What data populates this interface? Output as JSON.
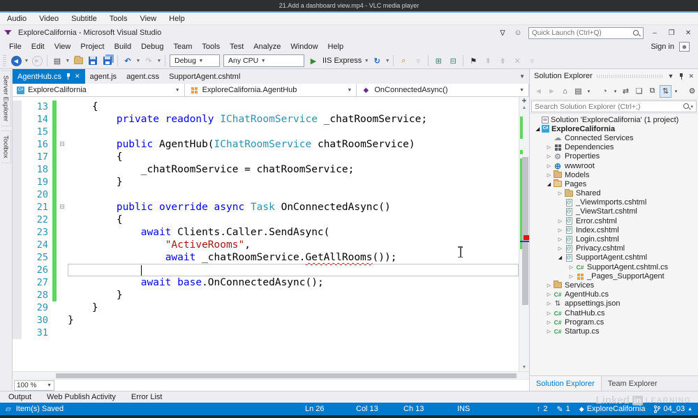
{
  "vlc": {
    "title": "21.Add a dashboard view.mp4 - VLC media player",
    "menu": [
      "Audio",
      "Video",
      "Subtitle",
      "Tools",
      "View",
      "Help"
    ]
  },
  "vs": {
    "title": "ExploreCalifornia - Microsoft Visual Studio",
    "quick_launch_placeholder": "Quick Launch (Ctrl+Q)",
    "sign_in": "Sign in",
    "window_buttons": [
      "–",
      "❐",
      "✕"
    ],
    "menu": [
      "File",
      "Edit",
      "View",
      "Project",
      "Build",
      "Debug",
      "Team",
      "Tools",
      "Test",
      "Analyze",
      "Window",
      "Help"
    ],
    "toolbar": {
      "debug_target": "Debug",
      "platform": "Any CPU",
      "run_label": "IIS Express",
      "icons": [
        {
          "type": "grip"
        },
        {
          "type": "icon",
          "name": "nav-back-icon",
          "glyph": "◀",
          "cls": "circle-blue"
        },
        {
          "type": "dd"
        },
        {
          "type": "icon",
          "name": "nav-forward-icon",
          "glyph": "▶",
          "cls": "circle-gray"
        },
        {
          "type": "sep"
        },
        {
          "type": "icon",
          "name": "new-file-icon",
          "glyph": "▤"
        },
        {
          "type": "dd"
        },
        {
          "type": "icon",
          "name": "open-folder-icon",
          "cls": "gl-folder"
        },
        {
          "type": "icon",
          "name": "save-icon",
          "cls": "gl-floppy"
        },
        {
          "type": "icon",
          "name": "save-all-icon",
          "cls": "gl-floppy gl-floppy2"
        },
        {
          "type": "sep"
        },
        {
          "type": "icon",
          "name": "undo-icon",
          "glyph": "↶",
          "color": "#2a6bc0",
          "bold": true
        },
        {
          "type": "dd"
        },
        {
          "type": "icon",
          "name": "redo-icon",
          "glyph": "↷",
          "dis": true
        },
        {
          "type": "dd"
        },
        {
          "type": "sep"
        },
        {
          "type": "combo",
          "name": "debug-target-combo",
          "bind": "debug_target",
          "width": 72
        },
        {
          "type": "combo",
          "name": "platform-combo",
          "bind": "platform",
          "width": 116
        },
        {
          "type": "icon",
          "name": "start-debug-icon",
          "glyph": "▶",
          "color": "#388a34"
        },
        {
          "type": "runlabel"
        },
        {
          "type": "dd"
        },
        {
          "type": "icon",
          "name": "refresh-icon",
          "glyph": "↻",
          "color": "#2a6bc0",
          "bold": true
        },
        {
          "type": "dd"
        },
        {
          "type": "sep"
        },
        {
          "type": "icon",
          "name": "find-in-files-icon",
          "glyph": "⌕",
          "color": "#c27d1a"
        },
        {
          "type": "icon",
          "name": "toolbar-overflow-icon",
          "glyph": "▿",
          "dis": true
        },
        {
          "type": "sep"
        },
        {
          "type": "icon",
          "name": "attach-process-icon",
          "glyph": "⊞",
          "color": "#3c7f63"
        },
        {
          "type": "icon",
          "name": "navigate-backward-doc-icon",
          "glyph": "⊟",
          "color": "#3c7f63"
        },
        {
          "type": "sep"
        },
        {
          "type": "icon",
          "name": "bookmark-icon",
          "glyph": "⚑",
          "color": "#2b2b2b"
        },
        {
          "type": "icon",
          "name": "prev-bookmark-icon",
          "glyph": "⇞",
          "dis": true
        },
        {
          "type": "icon",
          "name": "next-bookmark-icon",
          "glyph": "⇟",
          "dis": true
        },
        {
          "type": "icon",
          "name": "clear-bookmarks-icon",
          "glyph": "✕",
          "dis": true
        },
        {
          "type": "icon",
          "name": "overflow-icon",
          "glyph": "▿",
          "dis": true
        }
      ]
    }
  },
  "left_tabs": [
    "Server Explorer",
    "Toolbox"
  ],
  "editor": {
    "tabs": [
      {
        "label": "AgentHub.cs",
        "active": true
      },
      {
        "label": "agent.js"
      },
      {
        "label": "agent.css"
      },
      {
        "label": "SupportAgent.cshtml"
      }
    ],
    "breadcrumbs": [
      {
        "label": "ExploreCalifornia",
        "icon": "ic-proj",
        "glyph": "C#"
      },
      {
        "label": "ExploreCalifornia.AgentHub",
        "icon": "ic-class",
        "glyph": ""
      },
      {
        "label": "OnConnectedAsync()",
        "icon": "ic-method",
        "glyph": "◆"
      }
    ],
    "zoom": "100 %",
    "lines": [
      {
        "n": 13,
        "chg": true,
        "seg": [
          [
            "pl",
            "    {"
          ]
        ]
      },
      {
        "n": 14,
        "chg": true,
        "seg": [
          [
            "pl",
            "        "
          ],
          [
            "kw",
            "private"
          ],
          [
            "pl",
            " "
          ],
          [
            "kw",
            "readonly"
          ],
          [
            "pl",
            " "
          ],
          [
            "ty",
            "IChatRoomService"
          ],
          [
            "pl",
            " _chatRoomService;"
          ]
        ]
      },
      {
        "n": 15,
        "chg": true,
        "seg": []
      },
      {
        "n": 16,
        "chg": true,
        "fold": true,
        "seg": [
          [
            "pl",
            "        "
          ],
          [
            "kw",
            "public"
          ],
          [
            "pl",
            " AgentHub("
          ],
          [
            "ty",
            "IChatRoomService"
          ],
          [
            "pl",
            " chatRoomService)"
          ]
        ]
      },
      {
        "n": 17,
        "chg": true,
        "seg": [
          [
            "pl",
            "        {"
          ]
        ]
      },
      {
        "n": 18,
        "chg": true,
        "seg": [
          [
            "pl",
            "            _chatRoomService = chatRoomService;"
          ]
        ]
      },
      {
        "n": 19,
        "chg": true,
        "seg": [
          [
            "pl",
            "        }"
          ]
        ]
      },
      {
        "n": 20,
        "chg": true,
        "seg": []
      },
      {
        "n": 21,
        "chg": true,
        "fold": true,
        "seg": [
          [
            "pl",
            "        "
          ],
          [
            "kw",
            "public"
          ],
          [
            "pl",
            " "
          ],
          [
            "kw",
            "override"
          ],
          [
            "pl",
            " "
          ],
          [
            "kw",
            "async"
          ],
          [
            "pl",
            " "
          ],
          [
            "ty",
            "Task"
          ],
          [
            "pl",
            " OnConnectedAsync()"
          ]
        ]
      },
      {
        "n": 22,
        "chg": true,
        "seg": [
          [
            "pl",
            "        {"
          ]
        ]
      },
      {
        "n": 23,
        "chg": true,
        "seg": [
          [
            "pl",
            "            "
          ],
          [
            "kw",
            "await"
          ],
          [
            "pl",
            " Clients.Caller.SendAsync("
          ]
        ]
      },
      {
        "n": 24,
        "chg": true,
        "seg": [
          [
            "pl",
            "                "
          ],
          [
            "st",
            "\"ActiveRooms\""
          ],
          [
            "pl",
            ","
          ]
        ]
      },
      {
        "n": 25,
        "chg": true,
        "seg": [
          [
            "pl",
            "                "
          ],
          [
            "kw",
            "await"
          ],
          [
            "pl",
            " _chatRoomService."
          ],
          [
            "err",
            "GetAllRooms"
          ],
          [
            "pl",
            "());"
          ]
        ]
      },
      {
        "n": 26,
        "chg": true,
        "cur": true,
        "caret_col": 12,
        "seg": []
      },
      {
        "n": 27,
        "chg": true,
        "seg": [
          [
            "pl",
            "            "
          ],
          [
            "kw",
            "await"
          ],
          [
            "pl",
            " "
          ],
          [
            "kw",
            "base"
          ],
          [
            "pl",
            ".OnConnectedAsync();"
          ]
        ]
      },
      {
        "n": 28,
        "chg": true,
        "seg": [
          [
            "pl",
            "        }"
          ]
        ]
      },
      {
        "n": 29,
        "seg": [
          [
            "pl",
            "    }"
          ]
        ]
      },
      {
        "n": 30,
        "seg": [
          [
            "pl",
            "}"
          ]
        ]
      },
      {
        "n": 31,
        "seg": []
      }
    ]
  },
  "solution_explorer": {
    "title": "Solution Explorer",
    "search_placeholder": "Search Solution Explorer (Ctrl+;)",
    "toolbar_icons": [
      {
        "name": "se-back-icon",
        "glyph": "◄",
        "dis": true
      },
      {
        "name": "se-forward-icon",
        "glyph": "►",
        "dis": true
      },
      {
        "name": "se-home-icon",
        "glyph": "⌂"
      },
      {
        "name": "se-switch-views-icon",
        "glyph": "▤"
      },
      {
        "name": "se-dd-icon",
        "glyph": "▾",
        "dd": true
      },
      {
        "type": "sep"
      },
      {
        "name": "se-pending-changes-icon",
        "glyph": "◔"
      },
      {
        "name": "se-dd2-icon",
        "glyph": "▾",
        "dd": true
      },
      {
        "name": "se-refresh-icon",
        "glyph": "⇄"
      },
      {
        "name": "se-show-all-files-icon",
        "glyph": "❏"
      },
      {
        "name": "se-collapse-all-icon",
        "glyph": "⧉"
      },
      {
        "name": "se-sync-active-doc-icon",
        "glyph": "⇅",
        "boxed": true
      },
      {
        "name": "se-dd3-icon",
        "glyph": "▾",
        "dd": true
      },
      {
        "type": "sep"
      },
      {
        "name": "se-properties-icon",
        "glyph": "⚙"
      },
      {
        "name": "se-preview-icon",
        "glyph": "−",
        "boxedDark": true
      }
    ],
    "tree": [
      {
        "d": 0,
        "icon": "ic-sln",
        "glyph": "∞",
        "label": "Solution 'ExploreCalifornia' (1 project)"
      },
      {
        "d": 0,
        "arrow": "exp",
        "icon": "ic-proj",
        "glyph": "C#",
        "label": "ExploreCalifornia",
        "bold": true
      },
      {
        "d": 1,
        "icon": "ic-cloud",
        "glyph": "☁",
        "label": "Connected Services"
      },
      {
        "d": 1,
        "arrow": "col",
        "icon": "ic-blocks",
        "glyph": "",
        "label": "Dependencies"
      },
      {
        "d": 1,
        "arrow": "col",
        "icon": "ic-wrench",
        "glyph": "⚙",
        "label": "Properties"
      },
      {
        "d": 1,
        "arrow": "col",
        "icon": "ic-globe",
        "glyph": "⊕",
        "label": "wwwroot"
      },
      {
        "d": 1,
        "arrow": "col",
        "icon": "ic-folder",
        "glyph": "",
        "label": "Models"
      },
      {
        "d": 1,
        "arrow": "exp",
        "icon": "ic-folder-open",
        "glyph": "",
        "label": "Pages"
      },
      {
        "d": 2,
        "arrow": "col",
        "icon": "ic-folder",
        "glyph": "",
        "label": "Shared"
      },
      {
        "d": 2,
        "icon": "ic-razor",
        "glyph": "@",
        "label": "_ViewImports.cshtml"
      },
      {
        "d": 2,
        "icon": "ic-razor",
        "glyph": "@",
        "label": "_ViewStart.cshtml"
      },
      {
        "d": 2,
        "arrow": "col",
        "icon": "ic-razor",
        "glyph": "@",
        "label": "Error.cshtml"
      },
      {
        "d": 2,
        "arrow": "col",
        "icon": "ic-razor",
        "glyph": "@",
        "label": "Index.cshtml"
      },
      {
        "d": 2,
        "arrow": "col",
        "icon": "ic-razor",
        "glyph": "@",
        "label": "Login.cshtml"
      },
      {
        "d": 2,
        "arrow": "col",
        "icon": "ic-razor",
        "glyph": "@",
        "label": "Privacy.cshtml"
      },
      {
        "d": 2,
        "arrow": "exp",
        "icon": "ic-razor",
        "glyph": "@",
        "label": "SupportAgent.cshtml"
      },
      {
        "d": 3,
        "arrow": "col",
        "icon": "ic-cs",
        "glyph": "C#",
        "label": "SupportAgent.cshtml.cs"
      },
      {
        "d": 3,
        "arrow": "col",
        "icon": "ic-class",
        "glyph": "",
        "label": "_Pages_SupportAgent"
      },
      {
        "d": 1,
        "arrow": "col",
        "icon": "ic-folder",
        "glyph": "",
        "label": "Services"
      },
      {
        "d": 1,
        "arrow": "col",
        "icon": "ic-cs",
        "glyph": "C#",
        "label": "AgentHub.cs"
      },
      {
        "d": 1,
        "arrow": "col",
        "icon": "ic-json",
        "glyph": "⇅",
        "label": "appsettings.json"
      },
      {
        "d": 1,
        "arrow": "col",
        "icon": "ic-cs",
        "glyph": "C#",
        "label": "ChatHub.cs"
      },
      {
        "d": 1,
        "arrow": "col",
        "icon": "ic-cs",
        "glyph": "C#",
        "label": "Program.cs"
      },
      {
        "d": 1,
        "arrow": "col",
        "icon": "ic-cs",
        "glyph": "C#",
        "label": "Startup.cs"
      }
    ],
    "bottom_tabs": [
      {
        "label": "Solution Explorer",
        "active": true
      },
      {
        "label": "Team Explorer"
      }
    ]
  },
  "bottom_panel_tabs": [
    "Output",
    "Web Publish Activity",
    "Error List"
  ],
  "statusbar": {
    "message": "Item(s) Saved",
    "ln": "Ln 26",
    "col": "Col 13",
    "ch": "Ch 13",
    "mode": "INS",
    "up_count": "2",
    "edit_count": "1",
    "project": "ExploreCalifornia",
    "branch": "04_03"
  },
  "watermark": {
    "part1": "Linked",
    "part2": "in",
    "part3": "LEARNING"
  },
  "colors": {
    "accent": "#007acc",
    "keyword": "#0000e8",
    "type": "#2b91af",
    "string": "#a31515",
    "line_number": "#2b91af",
    "change_bar": "#5fd75f",
    "error_squiggle": "#e51400"
  }
}
